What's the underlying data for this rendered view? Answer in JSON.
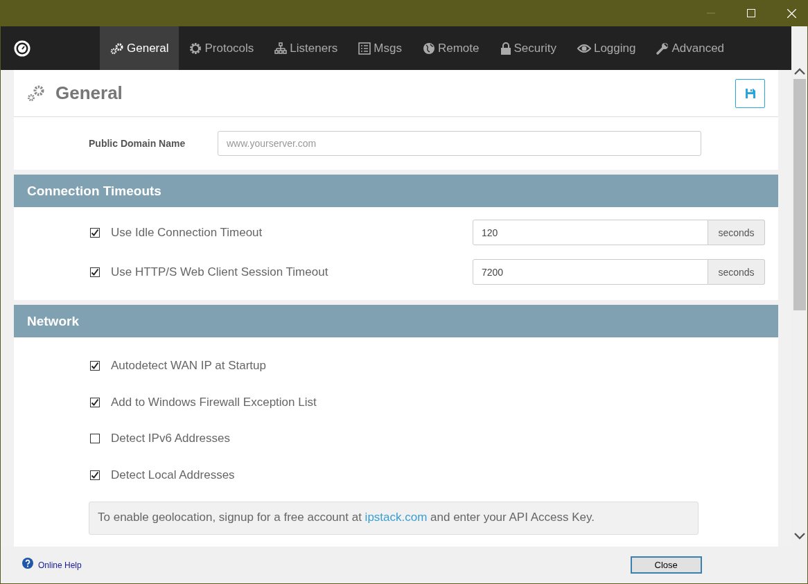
{
  "tabs": [
    {
      "label": "General",
      "selected": true
    },
    {
      "label": "Protocols",
      "selected": false
    },
    {
      "label": "Listeners",
      "selected": false
    },
    {
      "label": "Msgs",
      "selected": false
    },
    {
      "label": "Remote",
      "selected": false
    },
    {
      "label": "Security",
      "selected": false
    },
    {
      "label": "Logging",
      "selected": false
    },
    {
      "label": "Advanced",
      "selected": false
    }
  ],
  "page_title": "General",
  "public_domain": {
    "label": "Public Domain Name",
    "placeholder": "www.yourserver.com"
  },
  "connection_timeouts": {
    "title": "Connection Timeouts",
    "rows": [
      {
        "label": "Use Idle Connection Timeout",
        "checked": true,
        "value": "120",
        "unit": "seconds"
      },
      {
        "label": "Use HTTP/S Web Client Session Timeout",
        "checked": true,
        "value": "7200",
        "unit": "seconds"
      }
    ]
  },
  "network": {
    "title": "Network",
    "options": [
      {
        "label": "Autodetect WAN IP at Startup",
        "checked": true
      },
      {
        "label": "Add to Windows Firewall Exception List",
        "checked": true
      },
      {
        "label": "Detect IPv6 Addresses",
        "checked": false
      },
      {
        "label": "Detect Local Addresses",
        "checked": true
      }
    ],
    "info": {
      "before": "To enable geolocation, signup for a free account at",
      "link": "ipstack.com",
      "after": "and enter your API Access Key."
    }
  },
  "footer": {
    "help": "Online Help",
    "close": "Close"
  }
}
